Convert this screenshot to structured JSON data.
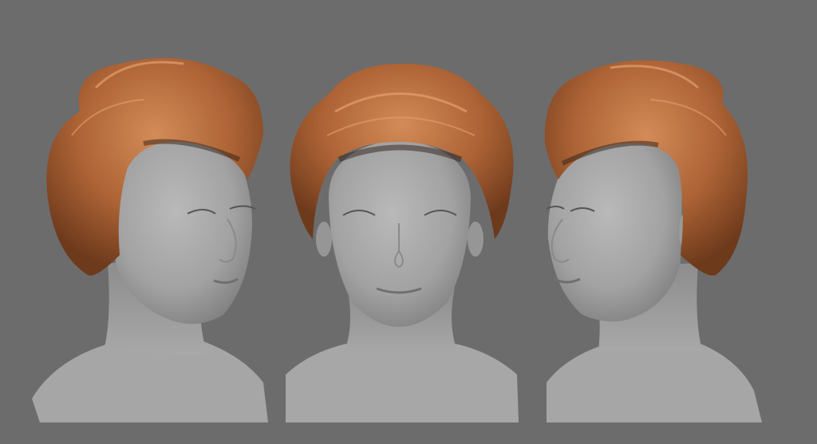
{
  "scene": {
    "background_color": "#6c6c6c",
    "skin_color": "#a9a9a9",
    "skin_shadow_color": "#7e7e7e",
    "hair_color": "#b06a3c",
    "hair_highlight_color": "#d89060",
    "hair_shadow_color": "#6e3a1c",
    "views": [
      {
        "id": "three-quarter-left",
        "icon": "head-render-icon"
      },
      {
        "id": "front",
        "icon": "head-render-icon"
      },
      {
        "id": "three-quarter-right",
        "icon": "head-render-icon"
      }
    ]
  }
}
